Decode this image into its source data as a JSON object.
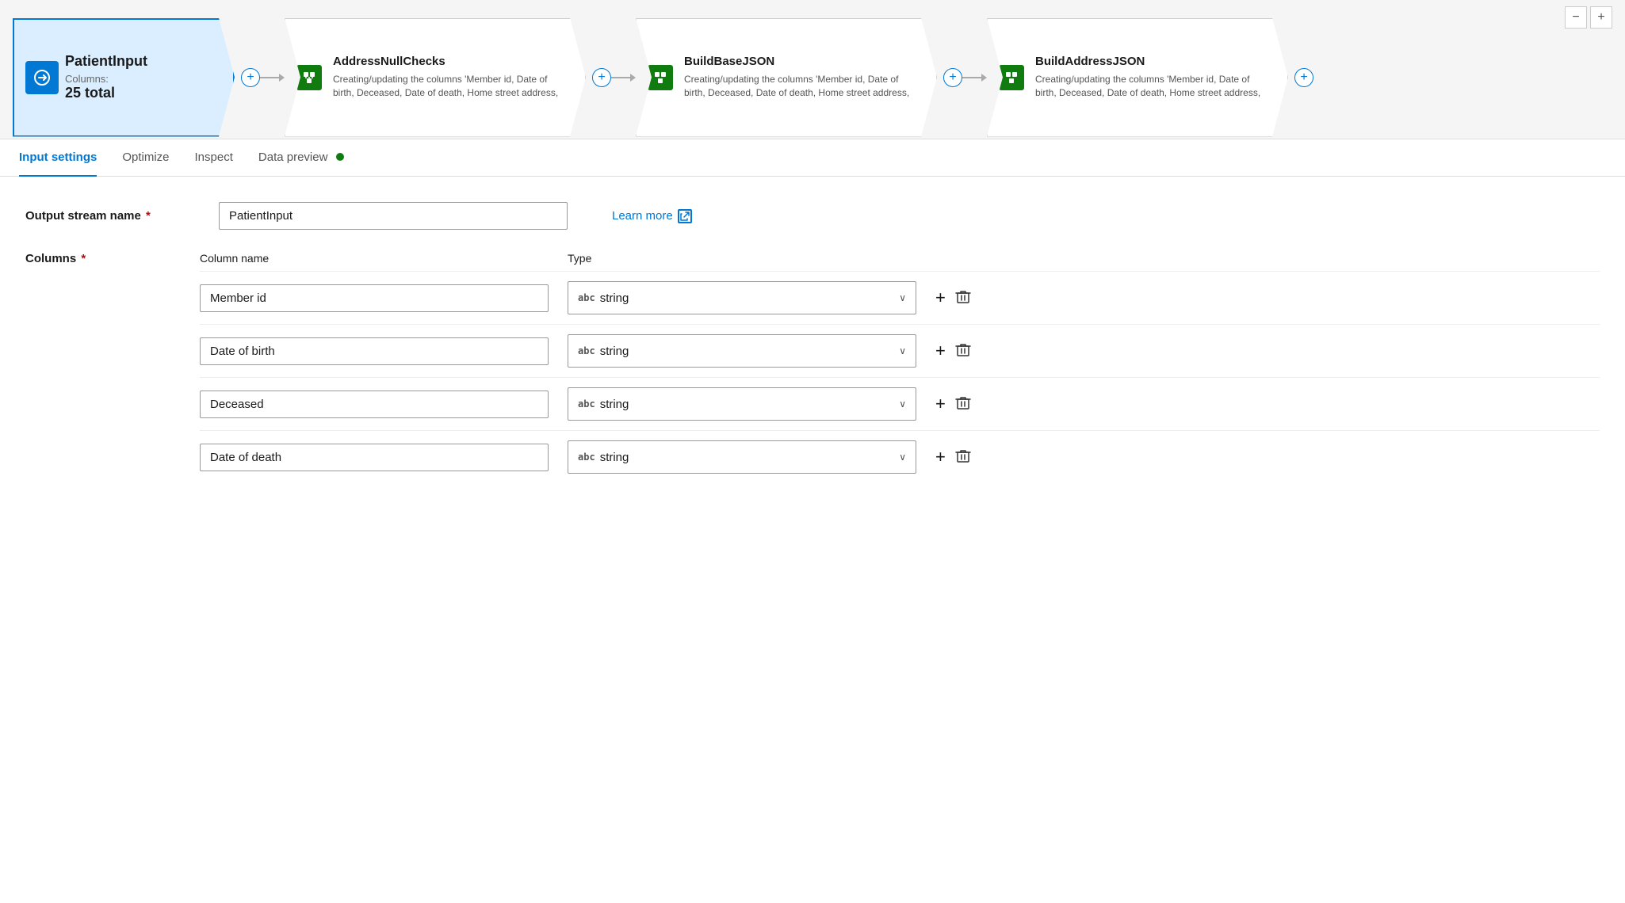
{
  "pipeline": {
    "nodes": [
      {
        "id": "patient-input",
        "title": "PatientInput",
        "subtitle": "Columns:",
        "value": "25 total",
        "type": "source",
        "iconType": "input"
      },
      {
        "id": "address-null-checks",
        "title": "AddressNullChecks",
        "description": "Creating/updating the columns 'Member id, Date of birth, Deceased, Date of death, Home street address,",
        "iconType": "transform"
      },
      {
        "id": "build-base-json",
        "title": "BuildBaseJSON",
        "description": "Creating/updating the columns 'Member id, Date of birth, Deceased, Date of death, Home street address,",
        "iconType": "transform"
      },
      {
        "id": "build-address-json",
        "title": "BuildAddressJSON",
        "description": "Creating/updating the columns 'Member id, Date of birth, Deceased, Date of death, Home street address,",
        "iconType": "transform"
      }
    ]
  },
  "tabs": {
    "items": [
      {
        "label": "Input settings",
        "active": true
      },
      {
        "label": "Optimize",
        "active": false
      },
      {
        "label": "Inspect",
        "active": false
      },
      {
        "label": "Data preview",
        "active": false,
        "hasDot": true
      }
    ]
  },
  "form": {
    "output_stream_name_label": "Output stream name",
    "output_stream_name_value": "PatientInput",
    "learn_more_label": "Learn more",
    "columns_label": "Columns",
    "col_header_name": "Column name",
    "col_header_type": "Type",
    "columns": [
      {
        "name": "Member id",
        "type": "string"
      },
      {
        "name": "Date of birth",
        "type": "string"
      },
      {
        "name": "Deceased",
        "type": "string"
      },
      {
        "name": "Date of death",
        "type": "string"
      }
    ],
    "type_prefix": "abc",
    "add_label": "+",
    "delete_label": "🗑"
  }
}
